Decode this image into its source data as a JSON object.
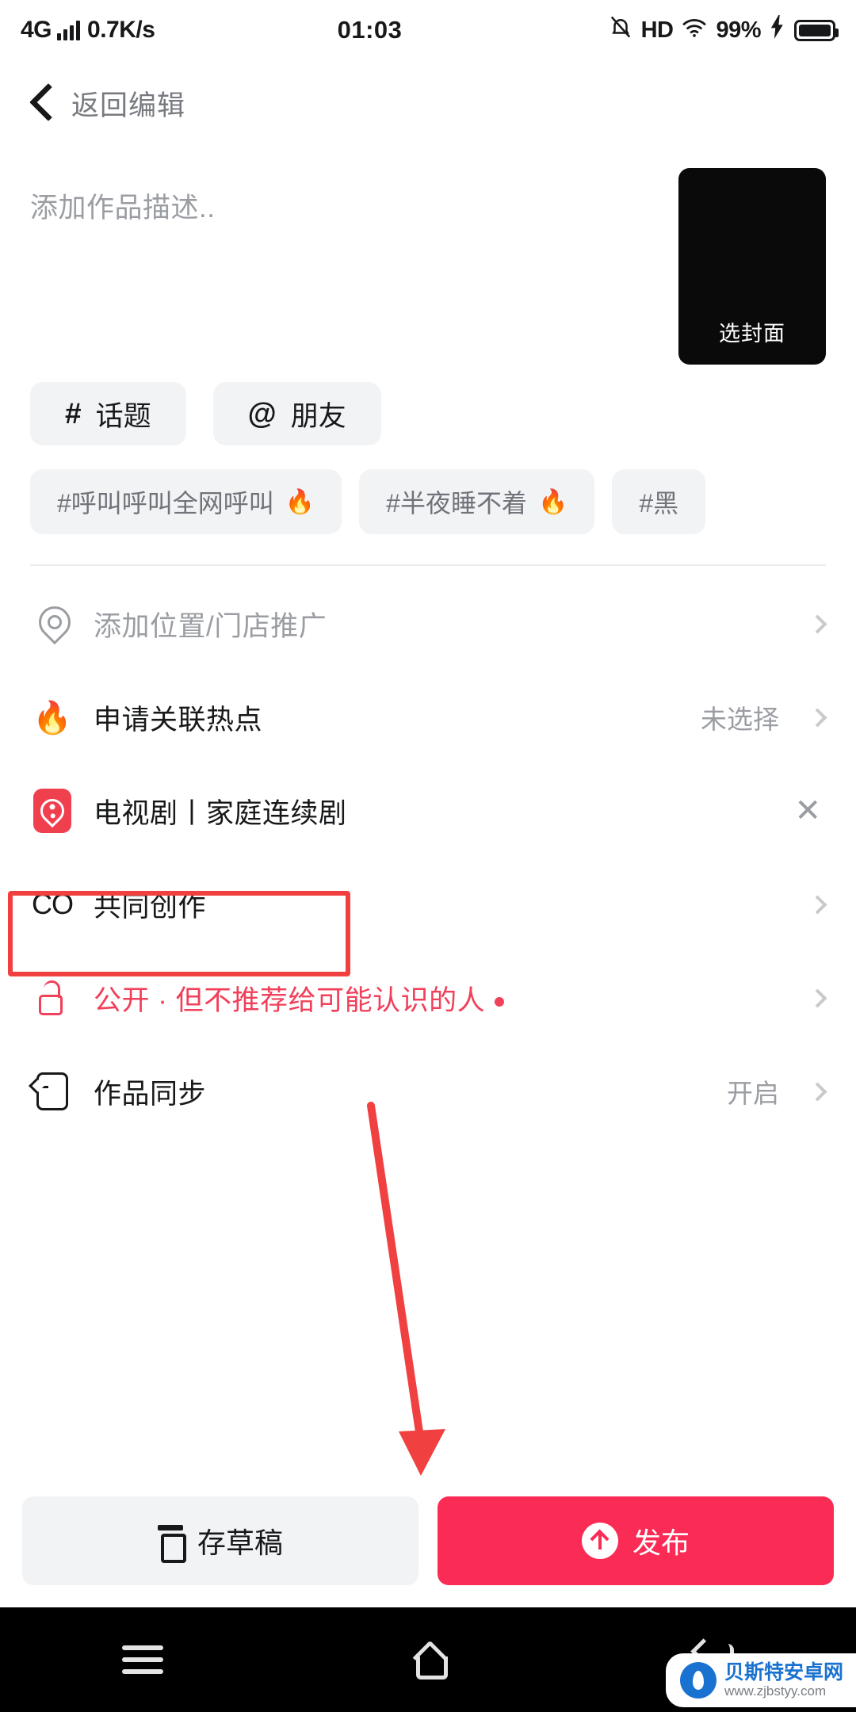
{
  "statusbar": {
    "network_type": "4G",
    "net_speed": "0.7K/s",
    "time": "01:03",
    "hd": "HD",
    "battery_pct": "99%",
    "mute_icon": "bell-muted-icon",
    "wifi_icon": "wifi-icon",
    "charge_icon": "charging-bolt-icon"
  },
  "nav": {
    "back_label": "返回编辑",
    "back_icon": "chevron-left-icon"
  },
  "description": {
    "placeholder": "添加作品描述..",
    "value": ""
  },
  "cover": {
    "label": "选封面"
  },
  "chips": [
    {
      "symbol": "#",
      "label": "话题",
      "name": "topic-chip"
    },
    {
      "symbol": "@",
      "label": "朋友",
      "name": "friend-chip"
    }
  ],
  "hashtags": [
    {
      "text": "#呼叫呼叫全网呼叫",
      "hot": "🔥"
    },
    {
      "text": "#半夜睡不着",
      "hot": "🔥"
    },
    {
      "text": "#黑",
      "hot": ""
    }
  ],
  "rows": {
    "location": {
      "label": "添加位置/门店推广",
      "icon": "location-pin-icon",
      "value": ""
    },
    "hotspot": {
      "label": "申请关联热点",
      "icon": "flame-icon",
      "value": "未选择"
    },
    "drama": {
      "label": "电视剧丨家庭连续剧",
      "icon": "film-reel-icon",
      "remove": "✕"
    },
    "coauthor": {
      "label": "共同创作",
      "icon": "co-icon",
      "value": ""
    },
    "privacy": {
      "label": "公开 · 但不推荐给可能认识的人",
      "icon": "unlock-icon"
    },
    "sync": {
      "label": "作品同步",
      "icon": "sync-icon",
      "value": "开启"
    }
  },
  "actions": {
    "draft_label": "存草稿",
    "draft_icon": "draft-box-icon",
    "publish_label": "发布",
    "publish_icon": "upload-arrow-icon"
  },
  "navbar": {
    "menu_icon": "menu-icon",
    "home_icon": "home-icon",
    "back_icon": "back-icon"
  },
  "watermark": {
    "name": "贝斯特安卓网",
    "url": "www.zjbstyy.com"
  },
  "colors": {
    "accent_red": "#fa2c55",
    "highlight_red": "#f04040",
    "privacy_red": "#f0405a",
    "muted": "#9a9da2"
  }
}
